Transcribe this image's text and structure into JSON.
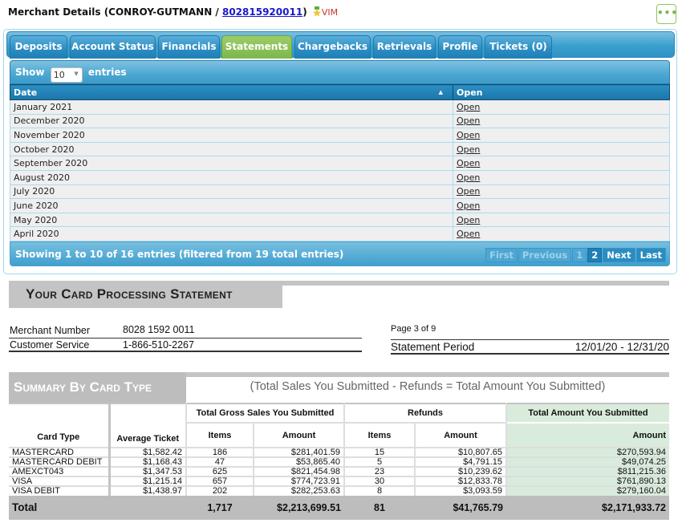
{
  "header": {
    "prefix": "Merchant Details (CONROY-GUTMANN / ",
    "merchant_id_link": "802815920011",
    "suffix": ")",
    "badge": "VIM"
  },
  "menu_button": "•••",
  "tabs": [
    {
      "label": "Deposits",
      "active": false
    },
    {
      "label": "Account Status",
      "active": false
    },
    {
      "label": "Financials",
      "active": false
    },
    {
      "label": "Statements",
      "active": true
    },
    {
      "label": "Chargebacks",
      "active": false
    },
    {
      "label": "Retrievals",
      "active": false
    },
    {
      "label": "Profile",
      "active": false
    },
    {
      "label": "Tickets (0)",
      "active": false
    }
  ],
  "datatable": {
    "show_label": "Show",
    "page_size": "10",
    "entries_label": "entries",
    "columns": [
      "Date",
      "Open"
    ],
    "rows": [
      {
        "date": "January 2021",
        "open": "Open"
      },
      {
        "date": "December 2020",
        "open": "Open"
      },
      {
        "date": "November 2020",
        "open": "Open"
      },
      {
        "date": "October 2020",
        "open": "Open"
      },
      {
        "date": "September 2020",
        "open": "Open"
      },
      {
        "date": "August 2020",
        "open": "Open"
      },
      {
        "date": "July 2020",
        "open": "Open"
      },
      {
        "date": "June 2020",
        "open": "Open"
      },
      {
        "date": "May 2020",
        "open": "Open"
      },
      {
        "date": "April 2020",
        "open": "Open"
      }
    ],
    "info": "Showing 1 to 10 of 16 entries (filtered from 19 total entries)",
    "pager": {
      "first": "First",
      "previous": "Previous",
      "pages": [
        "1",
        "2"
      ],
      "current": "2",
      "next": "Next",
      "last": "Last"
    }
  },
  "statement": {
    "title": "Your Card Processing Statement",
    "merchant_number_label": "Merchant Number",
    "merchant_number": "8028 1592 0011",
    "customer_service_label": "Customer Service",
    "customer_service": "1-866-510-2267",
    "page": "Page 3 of 9",
    "period_label": "Statement Period",
    "period": "12/01/20 - 12/31/20",
    "summary_title": "Summary By Card Type",
    "summary_subtitle": "(Total Sales You Submitted - Refunds = Total Amount You Submitted)",
    "headers": {
      "card_type": "Card Type",
      "avg_ticket": "Average Ticket",
      "gross_group": "Total Gross Sales You Submitted",
      "refunds_group": "Refunds",
      "total_group": "Total Amount You Submitted",
      "items": "Items",
      "amount": "Amount"
    },
    "rows": [
      {
        "card": "MASTERCARD",
        "avg": "$1,582.42",
        "gross_items": "186",
        "gross_amount": "$281,401.59",
        "ref_items": "15",
        "ref_amount": "$10,807.65",
        "total": "$270,593.94"
      },
      {
        "card": "MASTERCARD DEBIT",
        "avg": "$1,168.43",
        "gross_items": "47",
        "gross_amount": "$53,865.40",
        "ref_items": "5",
        "ref_amount": "$4,791.15",
        "total": "$49,074.25"
      },
      {
        "card": "AMEXCT043",
        "avg": "$1,347.53",
        "gross_items": "625",
        "gross_amount": "$821,454.98",
        "ref_items": "23",
        "ref_amount": "$10,239.62",
        "total": "$811,215.36"
      },
      {
        "card": "VISA",
        "avg": "$1,215.14",
        "gross_items": "657",
        "gross_amount": "$774,723.91",
        "ref_items": "30",
        "ref_amount": "$12,833.78",
        "total": "$761,890.13"
      },
      {
        "card": "VISA DEBIT",
        "avg": "$1,438.97",
        "gross_items": "202",
        "gross_amount": "$282,253.63",
        "ref_items": "8",
        "ref_amount": "$3,093.59",
        "total": "$279,160.04"
      }
    ],
    "totals": {
      "label": "Total",
      "gross_items": "1,717",
      "gross_amount": "$2,213,699.51",
      "ref_items": "81",
      "ref_amount": "$41,765.79",
      "total": "$2,171,933.72"
    }
  },
  "colors": {
    "tab_blue": "#2a8cc2",
    "tab_active_green": "#7cb84a",
    "link_blue": "#1a1acc",
    "vim_red": "#c8332b",
    "total_green": "#d9ecdc"
  }
}
